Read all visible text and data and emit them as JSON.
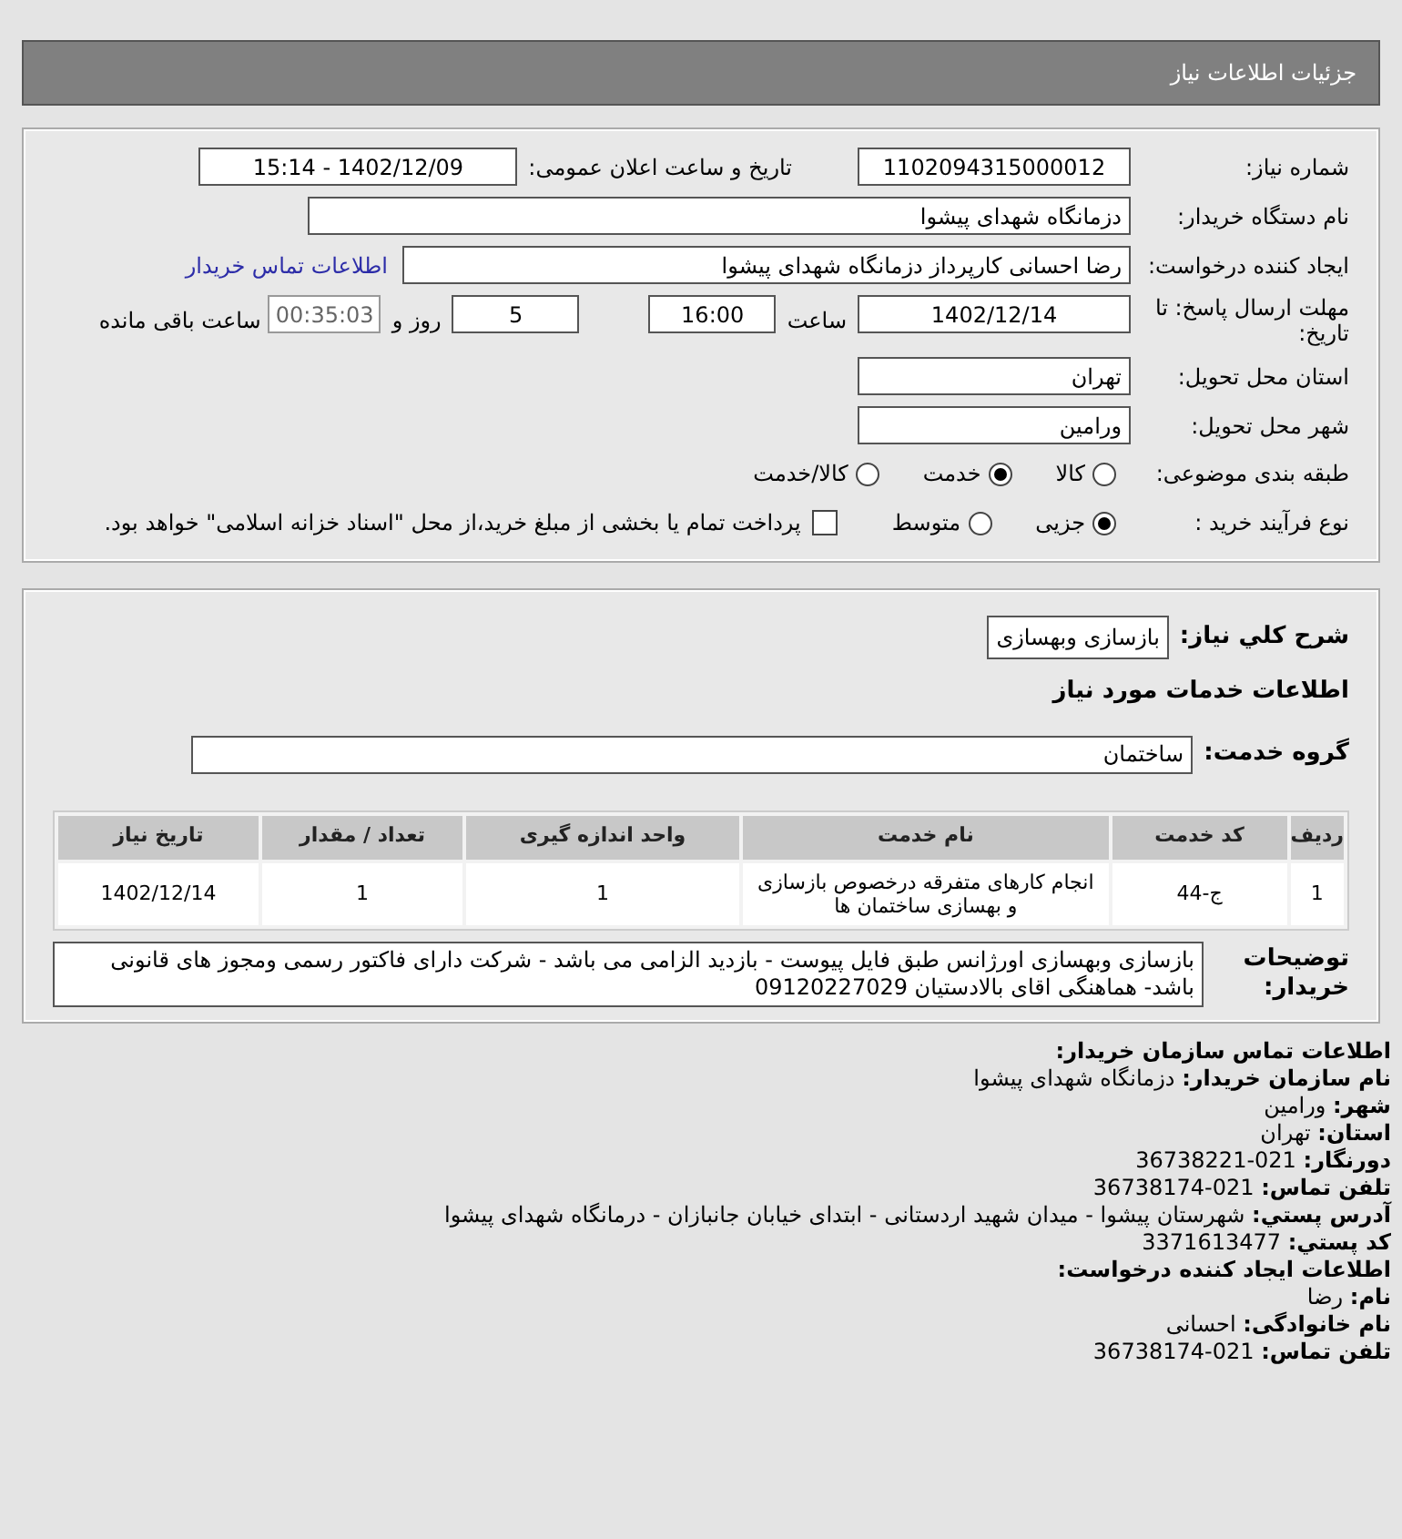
{
  "header": {
    "title": "جزئیات اطلاعات نیاز"
  },
  "need_number": {
    "label": "شماره نیاز:",
    "value": "1102094315000012"
  },
  "announce": {
    "label": "تاریخ و ساعت اعلان عمومی:",
    "value": "1402/12/09 - 15:14"
  },
  "buyer_org": {
    "label": "نام دستگاه خریدار:",
    "value": "دزمانگاه شهدای پیشوا"
  },
  "requester": {
    "label": "ایجاد کننده درخواست:",
    "value": "رضا احسانی کارپرداز دزمانگاه شهدای پیشوا",
    "link": "اطلاعات تماس خریدار"
  },
  "deadline": {
    "label": "مهلت ارسال پاسخ: تا تاریخ:",
    "date": "1402/12/14",
    "time_label": "ساعت",
    "time": "16:00",
    "days": "5",
    "days_label": "روز و",
    "remaining": "00:35:03",
    "remaining_label": "ساعت باقی مانده"
  },
  "province": {
    "label": "استان محل تحویل:",
    "value": "تهران"
  },
  "city": {
    "label": "شهر محل تحویل:",
    "value": "ورامین"
  },
  "category": {
    "label": "طبقه بندی موضوعی:",
    "options": [
      {
        "label": "کالا",
        "selected": false
      },
      {
        "label": "خدمت",
        "selected": true
      },
      {
        "label": "کالا/خدمت",
        "selected": false
      }
    ]
  },
  "process": {
    "label": "نوع فرآیند خرید :",
    "options": [
      {
        "label": "جزیی",
        "selected": true
      },
      {
        "label": "متوسط",
        "selected": false
      }
    ],
    "treasury": {
      "checked": false,
      "label": "پرداخت تمام یا بخشی از مبلغ خرید،از محل \"اسناد خزانه اسلامی\" خواهد بود."
    }
  },
  "summary": {
    "label": "شرح كلي نياز:",
    "value": "بازسازی وبهسازی"
  },
  "services_heading": "اطلاعات خدمات مورد نیاز",
  "service_group": {
    "label": "گروه خدمت:",
    "value": "ساختمان"
  },
  "table": {
    "columns": [
      "ردیف",
      "کد خدمت",
      "نام خدمت",
      "واحد اندازه گیری",
      "تعداد / مقدار",
      "تاریخ نیاز"
    ],
    "rows": [
      [
        "1",
        "ج-44",
        "انجام کارهای متفرقه درخصوص بازسازی و بهسازی ساختمان ها",
        "1",
        "1",
        "1402/12/14"
      ]
    ]
  },
  "buyer_notes": {
    "label": "توضیحات خریدار:",
    "value": "بازسازی وبهسازی اورژانس طبق فایل پیوست - بازدید الزامی می باشد - شرکت دارای فاکتور رسمی ومجوز های قانونی باشد- هماهنگی اقای بالادستیان 09120227029"
  },
  "contact": [
    {
      "label": "اطلاعات تماس سازمان خریدار:"
    },
    {
      "label": "نام سازمان خریدار:",
      "value": "دزمانگاه شهدای پیشوا"
    },
    {
      "label": "شهر:",
      "value": "ورامین"
    },
    {
      "label": "استان:",
      "value": "تهران"
    },
    {
      "label": "دورنگار:",
      "value": "36738221-021"
    },
    {
      "label": "تلفن تماس:",
      "value": "36738174-021"
    },
    {
      "label": "آدرس پستي:",
      "value": "شهرستان پیشوا - میدان شهید اردستانی - ابتدای خیابان جانبازان - درمانگاه شهدای پیشوا"
    },
    {
      "label": "کد پستي:",
      "value": "3371613477"
    },
    {
      "label": "اطلاعات ایجاد کننده درخواست:"
    },
    {
      "label": "نام:",
      "value": "رضا"
    },
    {
      "label": "نام خانوادگی:",
      "value": "احسانی"
    },
    {
      "label": "تلفن تماس:",
      "value": "36738174-021"
    }
  ]
}
